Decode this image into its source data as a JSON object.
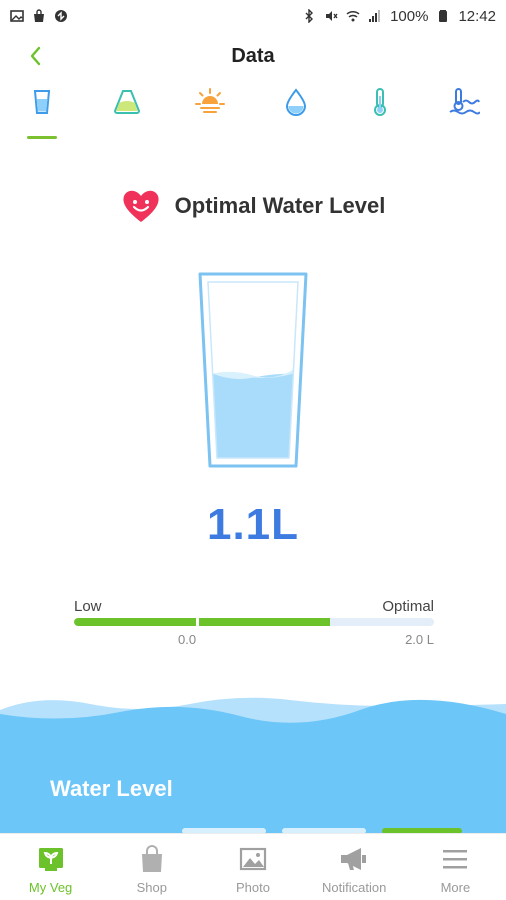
{
  "status_bar": {
    "battery": "100%",
    "time": "12:42"
  },
  "header": {
    "title": "Data"
  },
  "tabs": [
    {
      "icon": "water-glass-icon",
      "active": true
    },
    {
      "icon": "nutrient-flask-icon",
      "active": false
    },
    {
      "icon": "sun-icon",
      "active": false
    },
    {
      "icon": "water-drop-icon",
      "active": false
    },
    {
      "icon": "thermometer-icon",
      "active": false
    },
    {
      "icon": "water-temperature-icon",
      "active": false
    }
  ],
  "status": {
    "icon": "happy-heart-icon",
    "label": "Optimal Water Level"
  },
  "reading": {
    "value": "1.1L",
    "fill_fraction": 0.48
  },
  "gauge": {
    "low_label": "Low",
    "high_label": "Optimal",
    "min_label": "0.0",
    "max_label": "2.0 L",
    "fill_fraction": 0.71
  },
  "panel": {
    "title": "Water Level"
  },
  "bottom_nav": {
    "items": [
      {
        "label": "My Veg",
        "icon": "my-veg-icon",
        "active": true
      },
      {
        "label": "Shop",
        "icon": "shopping-bag-icon",
        "active": false
      },
      {
        "label": "Photo",
        "icon": "photo-icon",
        "active": false
      },
      {
        "label": "Notification",
        "icon": "megaphone-icon",
        "active": false
      },
      {
        "label": "More",
        "icon": "menu-icon",
        "active": false
      }
    ]
  },
  "colors": {
    "accent_green": "#6cc22a",
    "value_blue": "#3e7be0",
    "water_blue": "#6fc4f7",
    "heart_pink": "#f0325a"
  }
}
